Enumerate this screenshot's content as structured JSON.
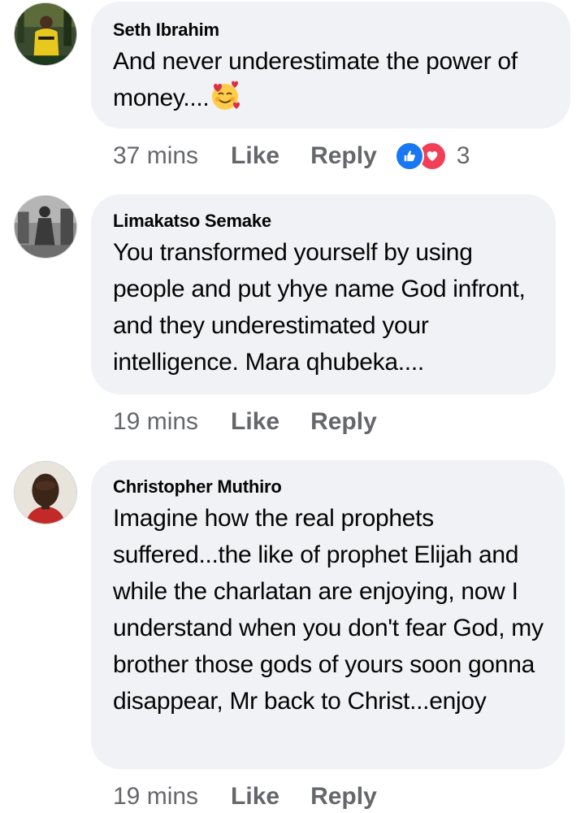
{
  "comments": [
    {
      "author": "Seth Ibrahim",
      "text": "And never underestimate the power of money....",
      "emoji": "smiling-face-with-hearts",
      "time": "37 mins",
      "like_label": "Like",
      "reply_label": "Reply",
      "reaction_count": "3",
      "reactions": [
        "like",
        "love"
      ]
    },
    {
      "author": "Limakatso Semake",
      "text": "You transformed yourself by using people and put yhye name God infront, and they underestimated your intelligence. Mara qhubeka....",
      "time": "19 mins",
      "like_label": "Like",
      "reply_label": "Reply"
    },
    {
      "author": "Christopher Muthiro",
      "text": "Imagine how the real prophets suffered...the like of prophet Elijah and while the charlatan are enjoying, now I understand when you don't fear God, my brother those gods of yours soon gonna disappear, Mr back to Christ...enjoy",
      "time": "19 mins",
      "like_label": "Like",
      "reply_label": "Reply"
    }
  ],
  "colors": {
    "bubble": "#f0f2f5",
    "meta_text": "#65676b",
    "like_blue": "#1877f2",
    "love_red": "#f33e58"
  }
}
